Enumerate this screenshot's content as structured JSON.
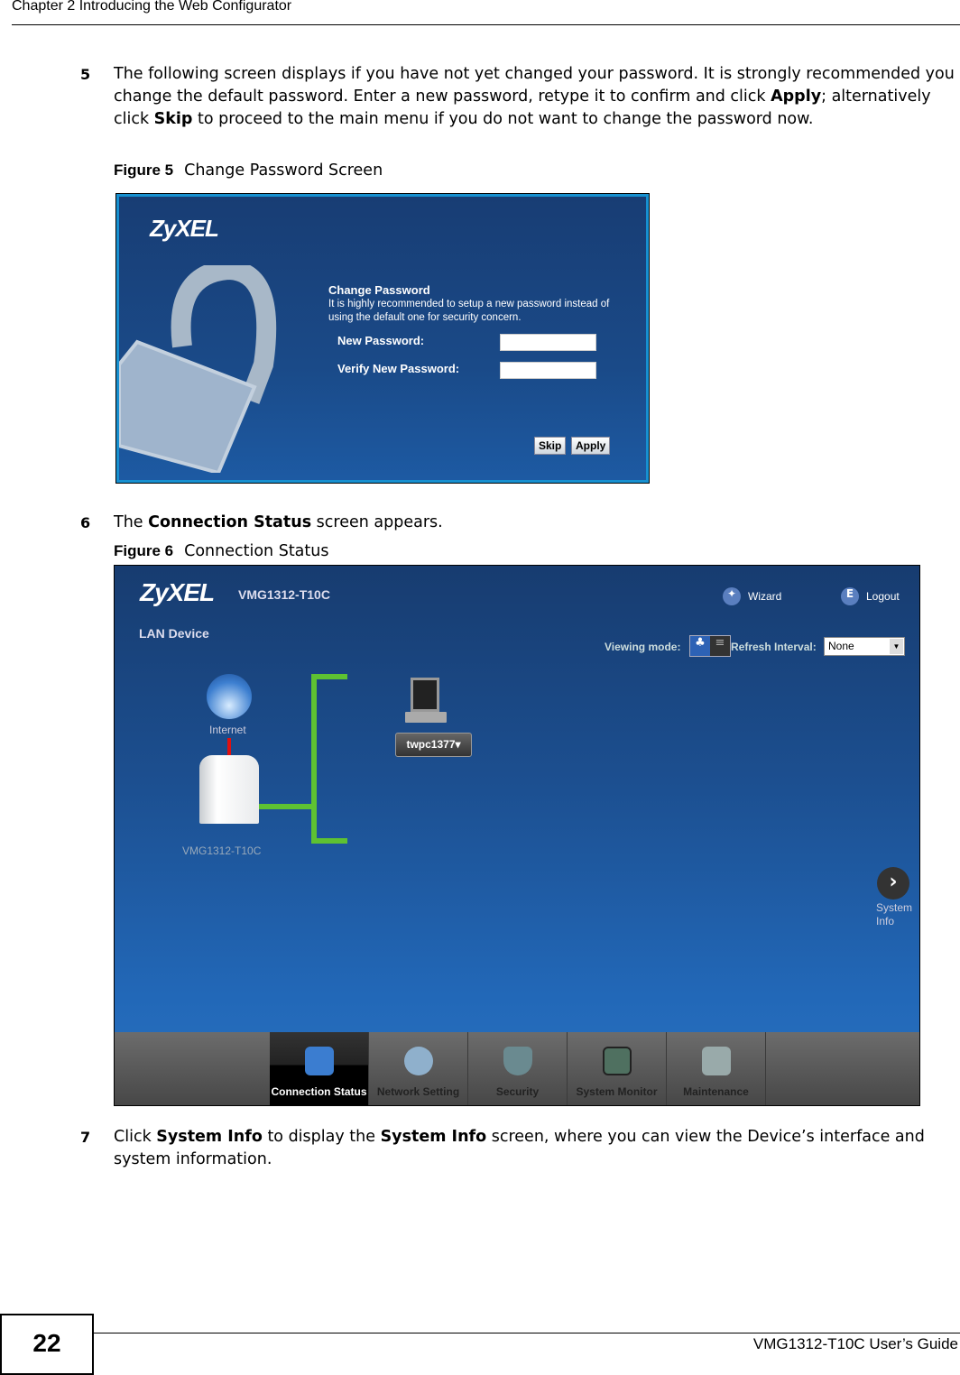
{
  "header": {
    "chapter": "Chapter 2 Introducing the Web Configurator"
  },
  "steps": [
    {
      "num": "5",
      "parts": [
        "The following screen displays if you have not yet changed your password. It is strongly recommended you change the default password. Enter a new password, retype it to confirm and click ",
        "Apply",
        "; alternatively click ",
        "Skip",
        " to proceed to the main menu if you do not want to change the password now."
      ]
    },
    {
      "num": "6",
      "parts": [
        "The ",
        "Connection Status",
        " screen appears."
      ]
    },
    {
      "num": "7",
      "parts": [
        "Click ",
        "System Info",
        " to display the ",
        "System Info",
        " screen, where you can view the Device’s interface and system information."
      ]
    }
  ],
  "figure5": {
    "label": "Figure 5",
    "title": "Change Password Screen",
    "logo": "ZyXEL",
    "heading": "Change Password",
    "description": "It is highly recommended to setup a new password instead of using the default one for security concern.",
    "new_password_label": "New Password:",
    "new_password_value": "",
    "verify_password_label": "Verify New Password:",
    "verify_password_value": "",
    "skip": "Skip",
    "apply": "Apply"
  },
  "figure6": {
    "label": "Figure 6",
    "title": "Connection Status",
    "logo": "ZyXEL",
    "model": "VMG1312-T10C",
    "wizard": "Wizard",
    "logout": "Logout",
    "section": "LAN Device",
    "viewing_mode_label": "Viewing mode:",
    "refresh_label": "Refresh Interval:",
    "refresh_value": "None",
    "internet": "Internet",
    "device_label": "VMG1312-T10C",
    "client": "twpc1377",
    "system_info": [
      "System",
      "Info"
    ],
    "tabs": [
      {
        "label": "Connection Status",
        "active": true,
        "icon": "monitor-globe-icon"
      },
      {
        "label": "Network Setting",
        "icon": "gear-icon"
      },
      {
        "label": "Security",
        "icon": "shield-icon"
      },
      {
        "label": "System Monitor",
        "icon": "chart-icon"
      },
      {
        "label": "Maintenance",
        "icon": "tools-icon"
      }
    ],
    "colors": {
      "link_line": "#5ec232",
      "wan_line": "#e01010"
    }
  },
  "footer": {
    "page": "22",
    "guide": "VMG1312-T10C User’s Guide"
  }
}
